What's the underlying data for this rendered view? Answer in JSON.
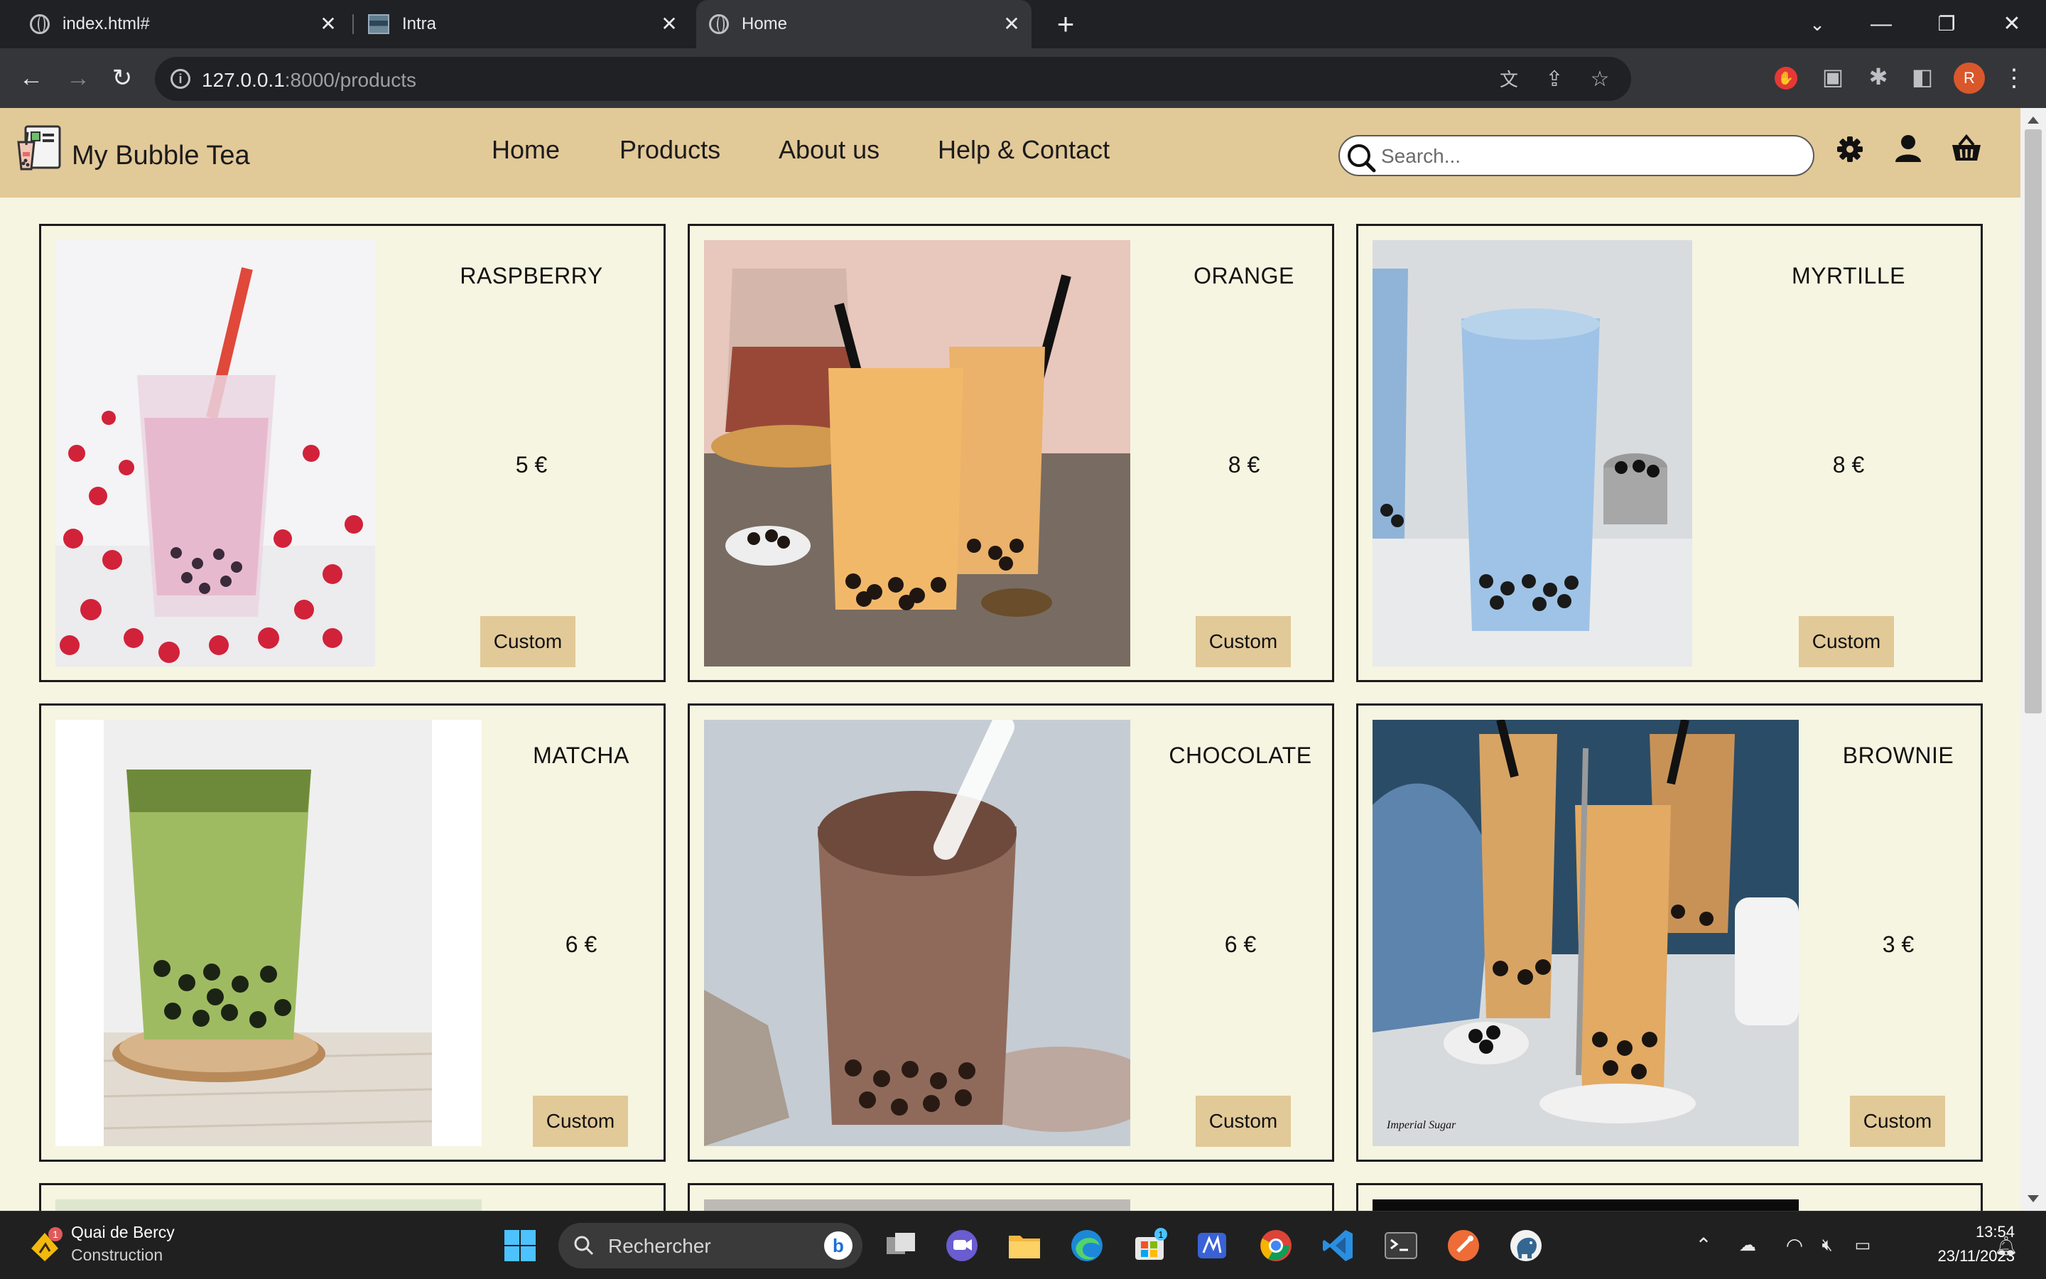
{
  "browser": {
    "tabs": [
      {
        "title": "index.html#",
        "icon": "globe-icon",
        "active": false
      },
      {
        "title": "Intra",
        "icon": "intra-icon",
        "active": false
      },
      {
        "title": "Home",
        "icon": "globe-icon",
        "active": true
      }
    ],
    "url_host": "127.0.0.1",
    "url_rest": ":8000/products",
    "profile_initial": "R"
  },
  "site": {
    "brand": "My Bubble Tea",
    "nav": [
      "Home",
      "Products",
      "About us",
      "Help & Contact"
    ],
    "search_placeholder": "Search...",
    "header_icons": [
      "gear-icon",
      "user-icon",
      "basket-icon"
    ],
    "colors": {
      "header": "#e2c998",
      "page": "#f5f5e1",
      "button": "#e2c998"
    }
  },
  "products": [
    {
      "name": "RASPBERRY",
      "price": "5 €",
      "button": "Custom",
      "drink_color": "#e7b9cf"
    },
    {
      "name": "ORANGE",
      "price": "8 €",
      "button": "Custom",
      "drink_color": "#eab26a"
    },
    {
      "name": "MYRTILLE",
      "price": "8 €",
      "button": "Custom",
      "drink_color": "#9fc3e6"
    },
    {
      "name": "MATCHA",
      "price": "6 €",
      "button": "Custom",
      "drink_color": "#9fbb62"
    },
    {
      "name": "CHOCOLATE",
      "price": "6 €",
      "button": "Custom",
      "drink_color": "#8f6a5a"
    },
    {
      "name": "BROWNIE",
      "price": "3 €",
      "button": "Custom",
      "drink_color": "#d8a464"
    }
  ],
  "photo_watermark": "Imperial Sugar",
  "taskbar": {
    "weather_title": "Quai de Bercy",
    "weather_subtitle": "Construction",
    "weather_badge": "1",
    "search_label": "Rechercher",
    "store_badge": "1",
    "time": "13:54",
    "date": "23/11/2023"
  }
}
